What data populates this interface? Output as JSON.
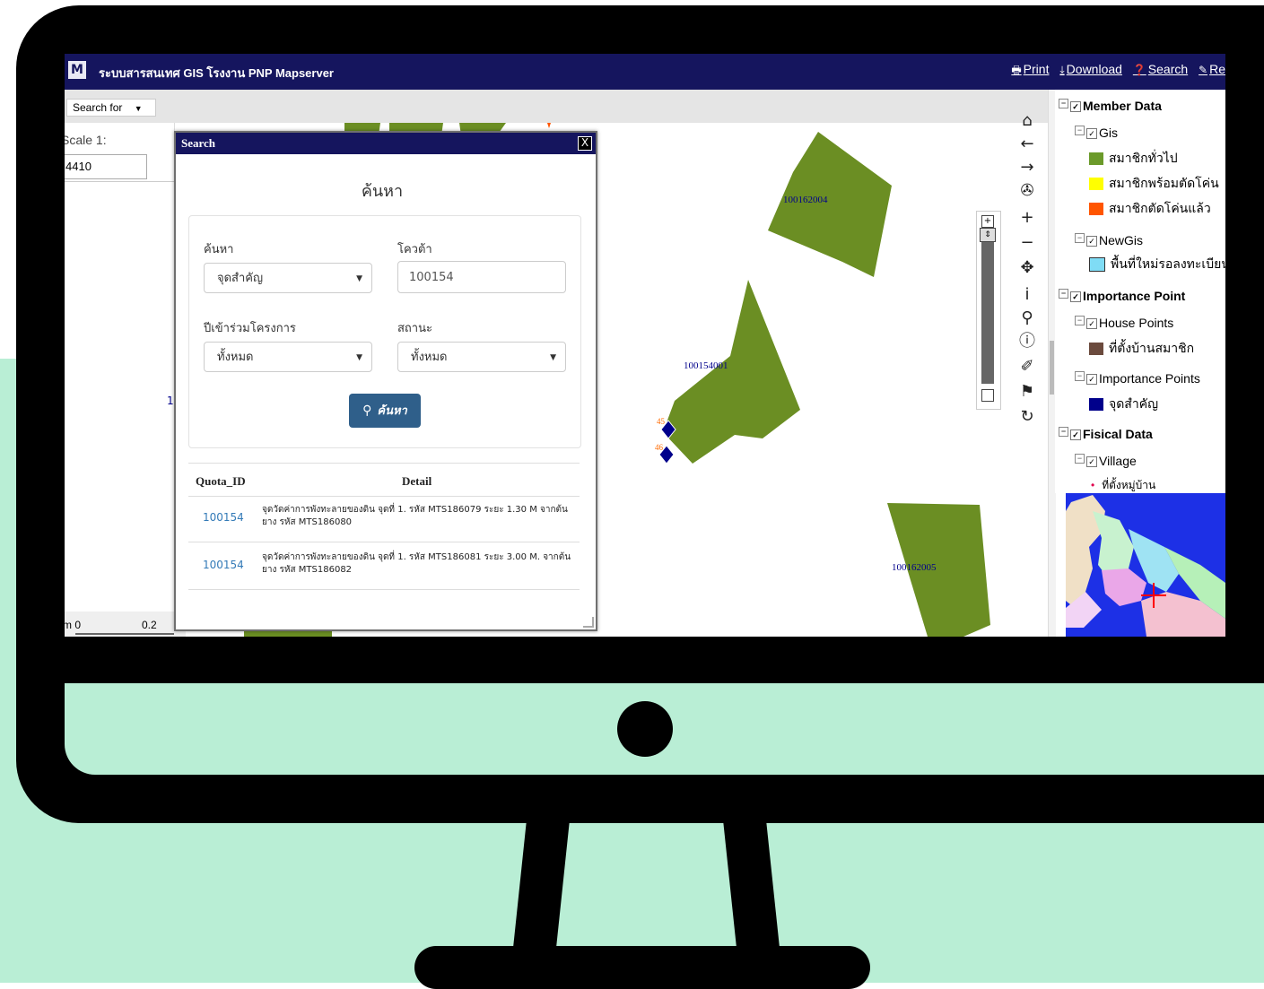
{
  "app": {
    "title": "ระบบสารสนเทศ GIS โรงงาน PNP Mapserver",
    "logo": "M"
  },
  "top_links": [
    {
      "label": "Print",
      "icon": "printer-icon"
    },
    {
      "label": "Download",
      "icon": "download-icon"
    },
    {
      "label": "Search",
      "icon": "help-icon"
    },
    {
      "label": "Re",
      "icon": "report-icon"
    }
  ],
  "search_for": {
    "label": "Search for"
  },
  "scale": {
    "label": "Scale 1:",
    "value": "4410",
    "bottom_left": "m 0",
    "bottom_right": "0.2",
    "stray": "1"
  },
  "map_labels": {
    "p1": "100162004",
    "p2": "100154001",
    "p3": "100162005",
    "pt1": "45",
    "pt2": "46"
  },
  "dialog": {
    "title": "Search",
    "close": "X",
    "heading": "ค้นหา",
    "fields": {
      "search_label": "ค้นหา",
      "search_value": "จุดสำคัญ",
      "quota_label": "โควต้า",
      "quota_value": "100154",
      "year_label": "ปีเข้าร่วมโครงการ",
      "year_value": "ทั้งหมด",
      "status_label": "สถานะ",
      "status_value": "ทั้งหมด"
    },
    "button": "ค้นหา",
    "table": {
      "headers": [
        "Quota_ID",
        "Detail"
      ],
      "rows": [
        {
          "id": "100154",
          "detail": "จุดวัดค่าการพังทะลายของดิน จุดที่ 1. รหัส MTS186079 ระยะ 1.30 M จากต้นยาง รหัส MTS186080"
        },
        {
          "id": "100154",
          "detail": "จุดวัดค่าการพังทะลายของดิน จุดที่ 1. รหัส MTS186081 ระยะ 3.00 M. จากต้นยาง รหัส MTS186082"
        }
      ]
    }
  },
  "layers": {
    "member_data": "Member Data",
    "gis": "Gis",
    "gis_items": [
      "สมาชิกทั่วไป",
      "สมาชิกพร้อมตัดโค่น",
      "สมาชิกตัดโค่นแล้ว"
    ],
    "newgis": "NewGis",
    "newgis_items": [
      "พื้นที่ใหม่รอลงทะเบียน"
    ],
    "importance_point": "Importance Point",
    "house_points": "House Points",
    "house_items": [
      "ที่ตั้งบ้านสมาชิก"
    ],
    "importance_points": "Importance Points",
    "importance_items": [
      "จุดสำคัญ"
    ],
    "fisical_data": "Fisical Data",
    "village": "Village",
    "village_items": [
      "ที่ตั้งหมู่บ้าน"
    ]
  },
  "colors": {
    "nav": "#15155e",
    "polygon": "#6b8e23",
    "swatch_green": "#6b9a2a",
    "swatch_yellow": "#ffff00",
    "swatch_orange": "#ff5500",
    "swatch_cyan": "#7fdcf5",
    "swatch_brown": "#6b4a3d",
    "swatch_navy": "#00008b",
    "mint": "#b9eed5"
  }
}
